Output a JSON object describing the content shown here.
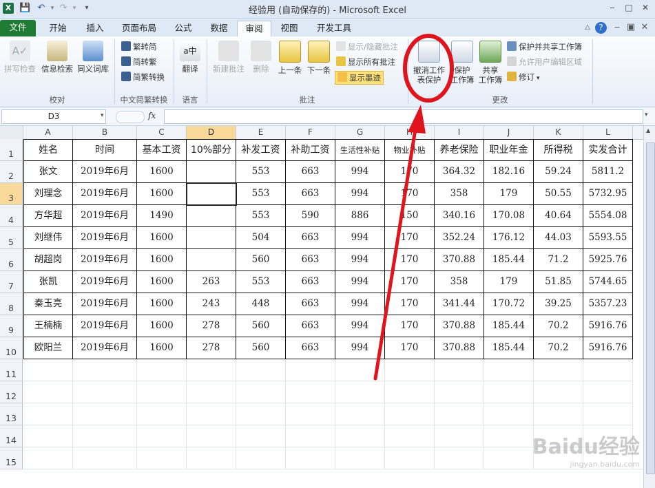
{
  "window": {
    "title": "经验用 (自动保存的) - Microsoft Excel",
    "app_icon": "X"
  },
  "tabs": [
    {
      "label": "文件"
    },
    {
      "label": "开始"
    },
    {
      "label": "插入"
    },
    {
      "label": "页面布局"
    },
    {
      "label": "公式"
    },
    {
      "label": "数据"
    },
    {
      "label": "审阅"
    },
    {
      "label": "视图"
    },
    {
      "label": "开发工具"
    }
  ],
  "ribbon": {
    "proofing": {
      "spell": "拼写检查",
      "research": "信息检索",
      "thesaurus": "同义词库",
      "label": "校对"
    },
    "chinese": {
      "t2s": "繁转简",
      "s2t": "简转繁",
      "convert": "简繁转换",
      "label": "中文简繁转换"
    },
    "language": {
      "translate": "翻译",
      "label": "语言"
    },
    "comments": {
      "new": "新建批注",
      "delete": "删除",
      "prev": "上一条",
      "next": "下一条",
      "showhide": "显示/隐藏批注",
      "showall": "显示所有批注",
      "ink": "显示墨迹",
      "label": "批注"
    },
    "changes": {
      "unprotect_l1": "撤消工作",
      "unprotect_l2": "表保护",
      "protectwb_l1": "保护",
      "protectwb_l2": "工作簿",
      "share_l1": "共享",
      "share_l2": "工作簿",
      "protect_share": "保护并共享工作簿",
      "allow_edit": "允许用户编辑区域",
      "track": "修订",
      "label": "更改"
    }
  },
  "formula_bar": {
    "namebox": "D3",
    "fx": "fx",
    "value": ""
  },
  "columns": [
    "A",
    "B",
    "C",
    "D",
    "E",
    "F",
    "G",
    "H",
    "I",
    "J",
    "K",
    "L"
  ],
  "rows": [
    "1",
    "2",
    "3",
    "4",
    "5",
    "6",
    "7",
    "8",
    "9",
    "10",
    "11",
    "12",
    "13",
    "14",
    "15"
  ],
  "table": {
    "headers": [
      "姓名",
      "时间",
      "基本工资",
      "10%部分",
      "补发工资",
      "补助工资",
      "生活性补贴",
      "物业补贴",
      "养老保险",
      "职业年金",
      "所得税",
      "实发合计"
    ],
    "rows": [
      [
        "张文",
        "2019年6月",
        "1600",
        "",
        "553",
        "663",
        "994",
        "170",
        "364.32",
        "182.16",
        "59.24",
        "5811.2"
      ],
      [
        "刘理念",
        "2019年6月",
        "1600",
        "",
        "553",
        "663",
        "994",
        "170",
        "358",
        "179",
        "50.55",
        "5732.95"
      ],
      [
        "方华超",
        "2019年6月",
        "1490",
        "",
        "553",
        "590",
        "886",
        "150",
        "340.16",
        "170.08",
        "40.64",
        "5554.08"
      ],
      [
        "刘继伟",
        "2019年6月",
        "1600",
        "",
        "504",
        "663",
        "994",
        "170",
        "352.24",
        "176.12",
        "44.03",
        "5593.55"
      ],
      [
        "胡超岗",
        "2019年6月",
        "1600",
        "",
        "560",
        "663",
        "994",
        "170",
        "370.88",
        "185.44",
        "71.2",
        "5925.76"
      ],
      [
        "张凯",
        "2019年6月",
        "1600",
        "263",
        "553",
        "663",
        "994",
        "170",
        "358",
        "179",
        "51.85",
        "5744.65"
      ],
      [
        "秦玉亮",
        "2019年6月",
        "1600",
        "243",
        "448",
        "663",
        "994",
        "170",
        "341.44",
        "170.72",
        "39.25",
        "5357.23"
      ],
      [
        "王楠楠",
        "2019年6月",
        "1600",
        "278",
        "560",
        "663",
        "994",
        "170",
        "370.88",
        "185.44",
        "70.2",
        "5916.76"
      ],
      [
        "欧阳兰",
        "2019年6月",
        "1600",
        "278",
        "560",
        "663",
        "994",
        "170",
        "370.88",
        "185.44",
        "70.2",
        "5916.76"
      ]
    ]
  },
  "watermark": {
    "brand": "Baidu经验",
    "url": "jingyan.baidu.com"
  },
  "colors": {
    "file_tab": "#1f7a34",
    "annotation": "#e0141c",
    "selected_header": "#f9d99a"
  }
}
